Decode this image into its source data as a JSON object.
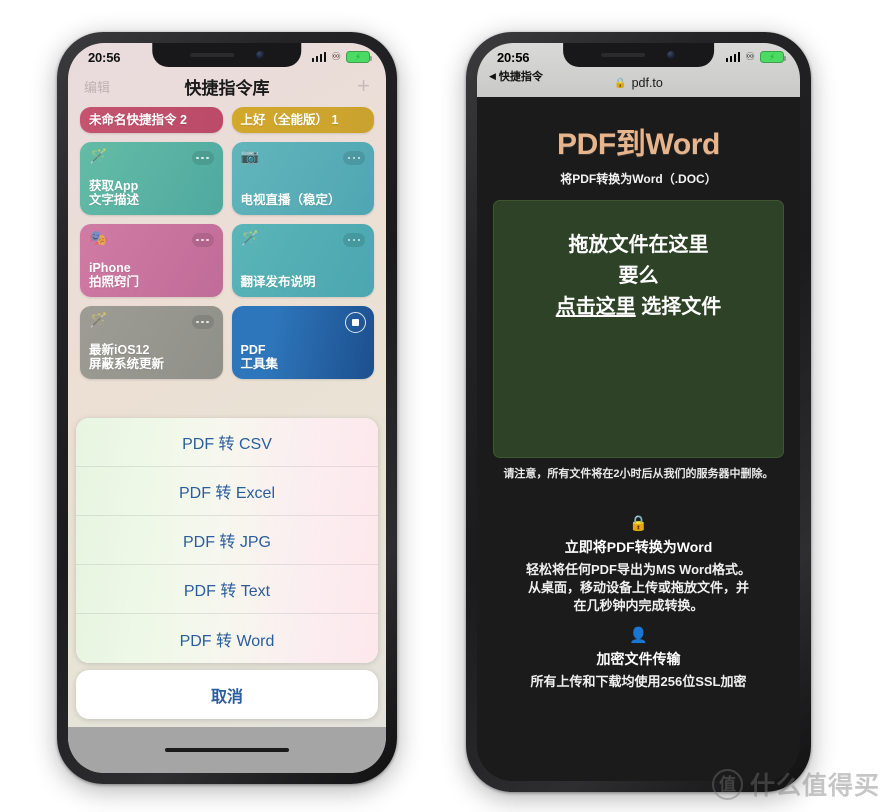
{
  "colors": {
    "accent_title": "#e8b48c",
    "dropzone_bg": "#2d4226",
    "sheet_text": "#2a5d9e",
    "battery_green": "#4cd964",
    "page_bg": "#1b1b1b"
  },
  "left_phone": {
    "status_bar": {
      "time": "20:56",
      "signal_icon": "cellular-signal-icon",
      "network_icon": "network-activity-icon",
      "battery_icon": "battery-charging-icon",
      "charging_glyph": "⚡"
    },
    "nav": {
      "edit_label": "编辑",
      "title": "快捷指令库",
      "add_label": "+"
    },
    "shortcuts": [
      {
        "name": "未命名快捷指令 2",
        "icon": "",
        "style": "slim",
        "bg": "linear-gradient(100deg,#c4546f,#bb4a68)",
        "has_dots": false,
        "running": false
      },
      {
        "name": "上好（全能版） 1",
        "icon": "",
        "style": "slim",
        "bg": "linear-gradient(100deg,#d3a82c,#c9a22f)",
        "has_dots": false,
        "running": false
      },
      {
        "name": "获取App\n文字描述",
        "icon": "🪄",
        "icon_name": "magic-wand-icon",
        "style": "tall",
        "bg": "linear-gradient(120deg,#64bca6,#4fa9a0)",
        "has_dots": true,
        "running": false
      },
      {
        "name": "电视直播（稳定）",
        "icon": "📷",
        "icon_name": "camera-icon",
        "style": "tall",
        "bg": "linear-gradient(120deg,#62b5bb,#4fa6b3)",
        "has_dots": true,
        "running": false
      },
      {
        "name": "iPhone\n拍照窍门",
        "icon": "🎭",
        "icon_name": "theater-masks-icon",
        "style": "tall",
        "bg": "linear-gradient(120deg,#d07ba4,#c06c98)",
        "has_dots": true,
        "running": false
      },
      {
        "name": "翻译发布说明",
        "icon": "🪄",
        "icon_name": "magic-wand-icon",
        "style": "tall",
        "bg": "linear-gradient(120deg,#5bb5b8,#4aa6b0)",
        "has_dots": true,
        "running": false
      },
      {
        "name": "最新iOS12\n屏蔽系统更新",
        "icon": "🪄",
        "icon_name": "magic-wand-icon",
        "style": "tall",
        "bg": "linear-gradient(120deg,#9d9d95,#90908a)",
        "has_dots": true,
        "running": false
      },
      {
        "name": "PDF\n工具集",
        "icon": "",
        "icon_name": "",
        "style": "tall",
        "bg": "linear-gradient(100deg,#2e76bb 0%,#2e76bb 28%,#1c4f8e 100%)",
        "has_dots": false,
        "running": true
      }
    ],
    "action_sheet": {
      "options": [
        "PDF 转 CSV",
        "PDF 转 Excel",
        "PDF 转 JPG",
        "PDF 转 Text",
        "PDF 转 Word"
      ],
      "cancel_label": "取消"
    },
    "home_indicator": "home-indicator"
  },
  "right_phone": {
    "status_bar": {
      "time": "20:56",
      "signal_icon": "cellular-signal-icon",
      "network_icon": "network-activity-icon",
      "battery_icon": "battery-charging-icon",
      "charging_glyph": "⚡"
    },
    "browser": {
      "back_label": "快捷指令",
      "back_arrow": "◀",
      "lock_glyph": "🔒",
      "url": "pdf.to"
    },
    "page": {
      "title": "PDF到Word",
      "subtitle": "将PDF转换为Word（.DOC）",
      "dropzone": {
        "line1": "拖放文件在这里",
        "line2": "要么",
        "line3_link": "点击这里",
        "line3_rest": " 选择文件"
      },
      "note": "请注意，所有文件将在2小时后从我们的服务器中删除。",
      "features": [
        {
          "icon": "🔒",
          "icon_name": "lock-icon",
          "heading": "立即将PDF转换为Word",
          "body": "轻松将任何PDF导出为MS Word格式。\n从桌面，移动设备上传或拖放文件，并\n在几秒钟内完成转换。"
        },
        {
          "icon": "👤",
          "icon_name": "user-lock-icon",
          "heading": "加密文件传输",
          "body": "所有上传和下载均使用256位SSL加密"
        }
      ]
    }
  },
  "watermark": {
    "logo_char": "值",
    "text": "什么值得买"
  }
}
